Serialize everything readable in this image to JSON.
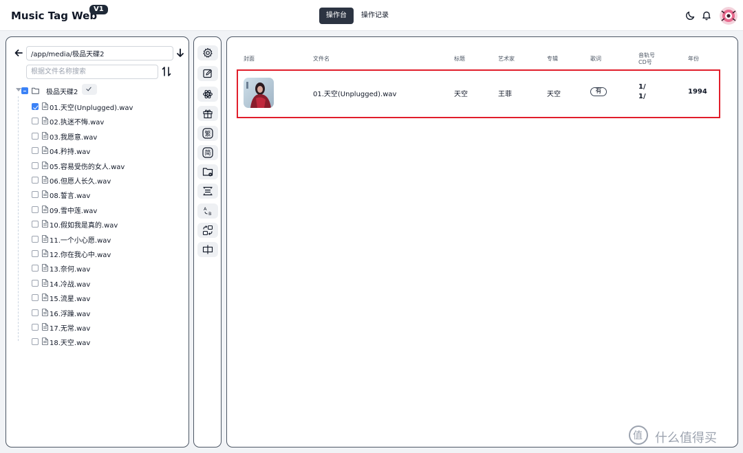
{
  "header": {
    "brand": "Music Tag Web",
    "version": "V1",
    "tabs": [
      {
        "label": "操作台",
        "active": true
      },
      {
        "label": "操作记录",
        "active": false
      }
    ],
    "icons": [
      "moon-icon",
      "bell-icon",
      "avatar"
    ]
  },
  "sidebar": {
    "path_value": "/app/media/极品天碟2",
    "search_placeholder": "根据文件名称搜索",
    "root_folder": "极品天碟2",
    "files": [
      {
        "name": "01.天空(Unplugged).wav",
        "checked": true
      },
      {
        "name": "02.执迷不悔.wav",
        "checked": false
      },
      {
        "name": "03.我愿意.wav",
        "checked": false
      },
      {
        "name": "04.矜持.wav",
        "checked": false
      },
      {
        "name": "05.容易受伤的女人.wav",
        "checked": false
      },
      {
        "name": "06.但愿人长久.wav",
        "checked": false
      },
      {
        "name": "08.誓言.wav",
        "checked": false
      },
      {
        "name": "09.雪中莲.wav",
        "checked": false
      },
      {
        "name": "10.假如我是真的.wav",
        "checked": false
      },
      {
        "name": "11.一个小心愿.wav",
        "checked": false
      },
      {
        "name": "12.你在我心中.wav",
        "checked": false
      },
      {
        "name": "13.奈何.wav",
        "checked": false
      },
      {
        "name": "14.冷战.wav",
        "checked": false
      },
      {
        "name": "15.流星.wav",
        "checked": false
      },
      {
        "name": "16.浮躁.wav",
        "checked": false
      },
      {
        "name": "17.无常.wav",
        "checked": false
      },
      {
        "name": "18.天空.wav",
        "checked": false
      }
    ]
  },
  "tools": [
    {
      "icon": "gear-icon"
    },
    {
      "icon": "edit-icon"
    },
    {
      "icon": "atom-icon"
    },
    {
      "icon": "gift-icon"
    },
    {
      "icon": "traditional-char-icon",
      "glyph": "繁"
    },
    {
      "icon": "simplified-char-icon",
      "glyph": "简"
    },
    {
      "icon": "folder-remove-icon"
    },
    {
      "icon": "align-vertical-icon"
    },
    {
      "icon": "letter-case-icon"
    },
    {
      "icon": "swap-icon"
    },
    {
      "icon": "split-icon"
    }
  ],
  "table": {
    "headers": {
      "cover": "封面",
      "filename": "文件名",
      "title": "标题",
      "artist": "艺术家",
      "album": "专辑",
      "lyrics": "歌词",
      "track": "音轨号",
      "cd": "CD号",
      "year": "年份"
    },
    "rows": [
      {
        "filename": "01.天空(Unplugged).wav",
        "title": "天空",
        "artist": "王菲",
        "album": "天空",
        "lyrics": "有",
        "track": "1/",
        "cd": "1/",
        "year": "1994"
      }
    ]
  },
  "watermark": {
    "glyph": "值",
    "text": "什么值得买"
  }
}
